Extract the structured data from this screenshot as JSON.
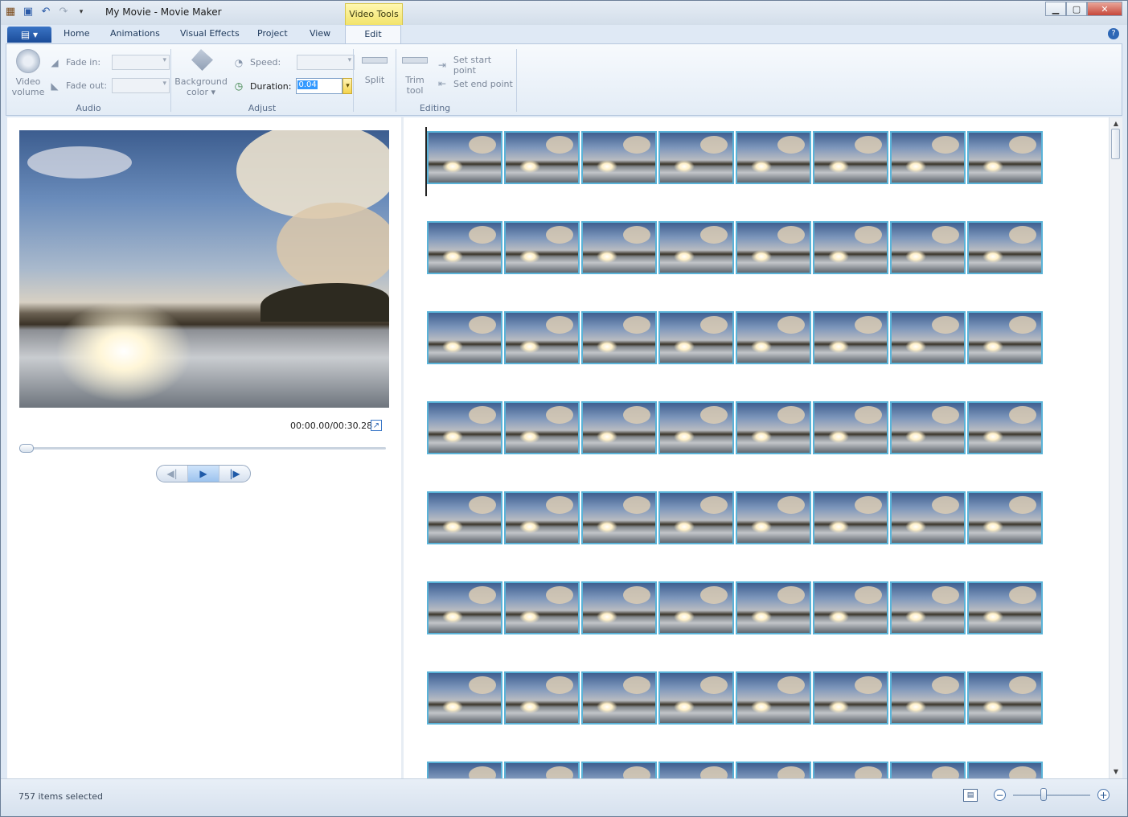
{
  "window": {
    "title": "My Movie - Movie Maker",
    "context_tab": "Video Tools",
    "minimize": "▁",
    "maximize": "▢",
    "close": "✕"
  },
  "quick_access": {
    "app_icon": "film-icon",
    "save_icon": "save-icon",
    "undo_icon": "undo-icon",
    "redo_icon": "redo-icon",
    "customize_icon": "dropdown-arrow-icon"
  },
  "tabs": {
    "app_menu": "▤ ▾",
    "items": [
      "Home",
      "Animations",
      "Visual Effects",
      "Project",
      "View",
      "Edit"
    ],
    "active": "Edit",
    "help": "?"
  },
  "ribbon": {
    "audio": {
      "label": "Audio",
      "video_volume": "Video\nvolume",
      "fade_in": "Fade in:",
      "fade_out": "Fade out:"
    },
    "adjust": {
      "label": "Adjust",
      "background_color": "Background\ncolor ▾",
      "speed": "Speed:",
      "duration": "Duration:",
      "duration_value": "0.04"
    },
    "editing": {
      "label": "Editing",
      "split": "Split",
      "trim_tool": "Trim\ntool",
      "set_start_point": "Set start point",
      "set_end_point": "Set end point"
    }
  },
  "preview": {
    "timecode": "00:00.00/00:30.28",
    "prev_frame": "◀|",
    "play": "▶",
    "next_frame": "|▶"
  },
  "storyboard": {
    "rows": 8,
    "clips_per_row": 8
  },
  "status": {
    "selected_text": "757 items selected",
    "zoom_out": "−",
    "zoom_in": "+",
    "zoom_level": 0.4
  },
  "colors": {
    "clip_border": "#5ab3d8",
    "context_tab": "#f2e36a",
    "app_menu": "#1b4c99"
  }
}
